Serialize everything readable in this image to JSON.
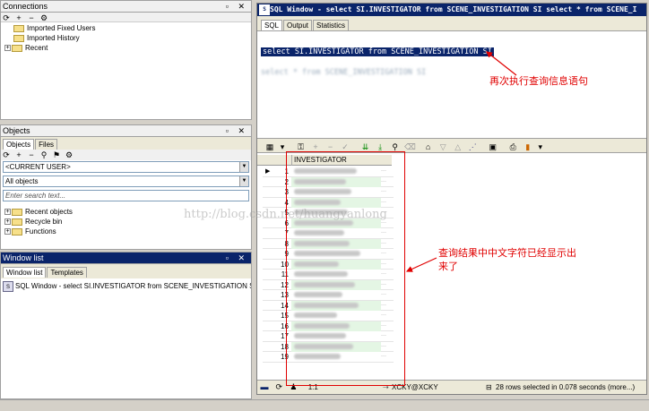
{
  "connections": {
    "title": "Connections",
    "items": [
      "Imported Fixed Users",
      "Imported History",
      "Recent"
    ]
  },
  "objects": {
    "title": "Objects",
    "tabs": [
      "Objects",
      "Files"
    ],
    "user_combo": "<CURRENT USER>",
    "filter_combo": "All objects",
    "search_placeholder": "Enter search text...",
    "items": [
      "Recent objects",
      "Recycle bin",
      "Functions"
    ]
  },
  "window_list": {
    "title": "Window list",
    "tabs": [
      "Window list",
      "Templates"
    ],
    "item": "SQL Window - select SI.INVESTIGATOR from SCENE_INVESTIGATION SI"
  },
  "sql_window": {
    "title": "SQL Window - select SI.INVESTIGATOR from SCENE_INVESTIGATION SI select * from SCENE_I",
    "tabs": [
      "SQL",
      "Output",
      "Statistics"
    ],
    "line1": "select SI.INVESTIGATOR from SCENE_INVESTIGATION SI",
    "line2": "select * from SCENE_INVESTIGATION SI"
  },
  "grid": {
    "column": "INVESTIGATOR",
    "row_numbers": [
      "1",
      "2",
      "3",
      "4",
      "5",
      "6",
      "7",
      "8",
      "9",
      "10",
      "11",
      "12",
      "13",
      "14",
      "15",
      "16",
      "17",
      "18",
      "19"
    ]
  },
  "status": {
    "position": "1:1",
    "connection": "XCKY@XCKY",
    "message": "28 rows selected in 0.078 seconds (more...)"
  },
  "watermark": "http://blog.csdn.net/huangyanlong",
  "annotations": {
    "query": "再次执行查询信息语句",
    "result_line1": "查询结果中中文字符已经显示出",
    "result_line2": "来了"
  },
  "colors": {
    "annotation": "#e00000",
    "selection": "#0a246a",
    "row_green": "#e4f6e4"
  }
}
